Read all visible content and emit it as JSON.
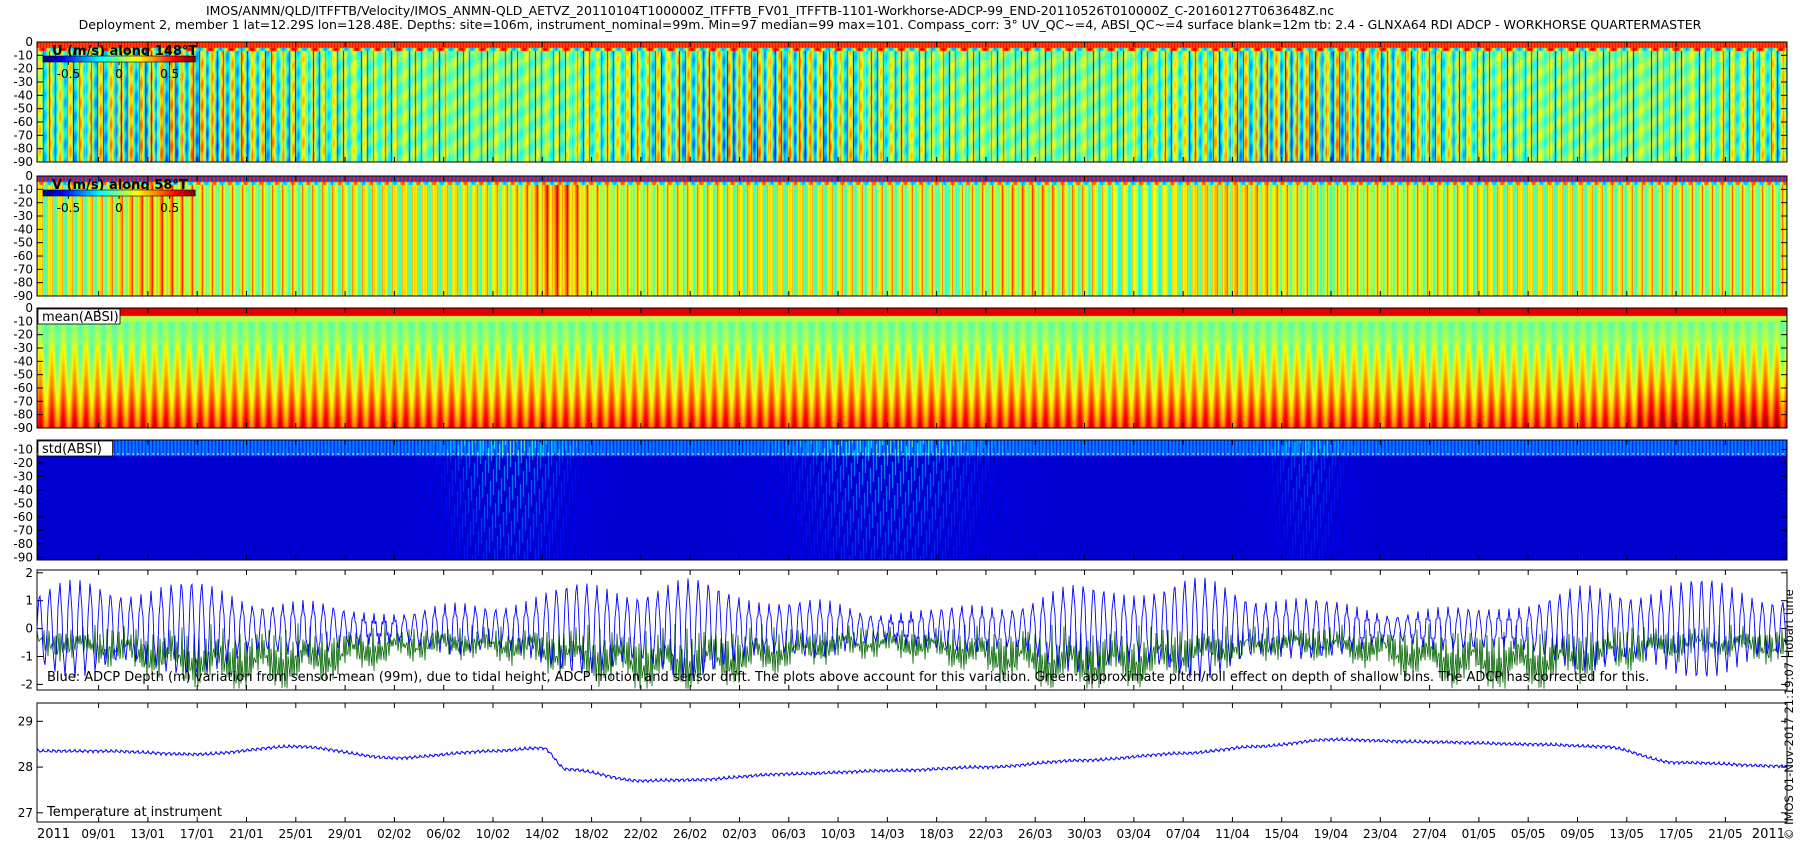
{
  "header": {
    "line1": "IMOS/ANMN/QLD/ITFFTB/Velocity/IMOS_ANMN-QLD_AETVZ_20110104T100000Z_ITFFTB_FV01_ITFFTB-1101-Workhorse-ADCP-99_END-20110526T010000Z_C-20160127T063648Z.nc",
    "line2": "Deployment 2, member 1 lat=12.29S lon=128.48E. Depths: site=106m, instrument_nominal=99m. Min=97 median=99 max=101. Compass_corr: 3° UV_QC~=4, ABSI_QC~=4 surface blank=12m tb: 2.4 - GLNXA64 RDI ADCP - WORKHORSE QUARTERMASTER"
  },
  "side_stamp": "© IMOS 01-Nov-2017 21:19:07 Hobart time",
  "colors": {
    "depth_line": "#0000ff",
    "pitch_roll_line": "#006400",
    "temperature_line": "#0000ff",
    "colormap": [
      "#00007f",
      "#0000ff",
      "#0080ff",
      "#00ffff",
      "#80ff80",
      "#ffff00",
      "#ff8000",
      "#ff0000",
      "#7f0000"
    ]
  },
  "x_axis": {
    "year_start": "2011",
    "year_end": "2011",
    "tick_labels": [
      "09/01",
      "13/01",
      "17/01",
      "21/01",
      "25/01",
      "29/01",
      "02/02",
      "06/02",
      "10/02",
      "14/02",
      "18/02",
      "22/02",
      "26/02",
      "02/03",
      "06/03",
      "10/03",
      "14/03",
      "18/03",
      "22/03",
      "26/03",
      "30/03",
      "03/04",
      "07/04",
      "11/04",
      "15/04",
      "19/04",
      "23/04",
      "27/04",
      "01/05",
      "05/05",
      "09/05",
      "13/05",
      "17/05",
      "21/05"
    ]
  },
  "panels": {
    "u": {
      "label": "U (m/s) along 148°T",
      "colorbar_ticks": [
        "-0.5",
        "0",
        "0.5"
      ],
      "y_ticks": [
        "0",
        "-10",
        "-20",
        "-30",
        "-40",
        "-50",
        "-60",
        "-70",
        "-80",
        "-90"
      ]
    },
    "v": {
      "label": "V (m/s) along 58°T",
      "colorbar_ticks": [
        "-0.5",
        "0",
        "0.5"
      ],
      "y_ticks": [
        "0",
        "-10",
        "-20",
        "-30",
        "-40",
        "-50",
        "-60",
        "-70",
        "-80",
        "-90"
      ]
    },
    "mean_absi": {
      "label": "mean(ABSI)",
      "y_ticks": [
        "0",
        "-10",
        "-20",
        "-30",
        "-40",
        "-50",
        "-60",
        "-70",
        "-80",
        "-90"
      ]
    },
    "std_absi": {
      "label": "std(ABSI)",
      "y_ticks": [
        "-10",
        "-20",
        "-30",
        "-40",
        "-50",
        "-60",
        "-70",
        "-80",
        "-90"
      ]
    },
    "depth": {
      "annotation": "Blue: ADCP Depth (m) variation from sensor-mean (99m), due to tidal height, ADCP motion and sensor drift. The plots above account for this variation. Green: approximate pitch/roll effect on depth of shallow bins. The ADCP has corrected for this.",
      "y_ticks": [
        "2",
        "1",
        "0",
        "-1",
        "-2"
      ]
    },
    "temperature": {
      "annotation": "Temperature at instrument",
      "y_ticks": [
        "29",
        "28",
        "27"
      ]
    }
  },
  "chart_data": [
    {
      "type": "heatmap",
      "name": "U (m/s) along 148°T",
      "x_range": [
        "2011-01-04",
        "2011-05-26"
      ],
      "y_range": [
        -90,
        0
      ],
      "color_range": [
        -0.75,
        0.75
      ],
      "description_values": "alternating tidal bands, mostly near 0"
    },
    {
      "type": "heatmap",
      "name": "V (m/s) along 58°T",
      "x_range": [
        "2011-01-04",
        "2011-05-26"
      ],
      "y_range": [
        -90,
        0
      ],
      "color_range": [
        -0.75,
        0.75
      ]
    },
    {
      "type": "heatmap",
      "name": "mean(ABSI)",
      "x_range": [
        "2011-01-04",
        "2011-05-26"
      ],
      "y_range": [
        -90,
        0
      ]
    },
    {
      "type": "heatmap",
      "name": "std(ABSI)",
      "x_range": [
        "2011-01-04",
        "2011-05-26"
      ],
      "y_range": [
        -90,
        0
      ]
    },
    {
      "type": "line",
      "x_range": [
        "2011-01-04",
        "2011-05-26"
      ],
      "ylim": [
        -2.2,
        2.1
      ],
      "series": [
        {
          "name": "ADCP Depth variation (m)",
          "color": "#0000ff",
          "amplitude_range": [
            -1.3,
            2.0
          ]
        },
        {
          "name": "pitch/roll effect",
          "color": "#006400",
          "amplitude_range": [
            -2.0,
            0.3
          ]
        }
      ]
    },
    {
      "type": "line",
      "x_range": [
        "2011-01-04",
        "2011-05-26"
      ],
      "ylim": [
        26.8,
        29.4
      ],
      "series": [
        {
          "name": "Temperature at instrument",
          "color": "#0000ff",
          "x": [
            "2011-01-04",
            "2011-01-09",
            "2011-01-17",
            "2011-01-25",
            "2011-02-02",
            "2011-02-10",
            "2011-02-14",
            "2011-02-16",
            "2011-02-22",
            "2011-02-26",
            "2011-03-06",
            "2011-03-14",
            "2011-03-22",
            "2011-03-30",
            "2011-04-07",
            "2011-04-13",
            "2011-04-19",
            "2011-04-27",
            "2011-05-05",
            "2011-05-11",
            "2011-05-17",
            "2011-05-26"
          ],
          "y": [
            28.35,
            28.35,
            28.28,
            28.45,
            28.2,
            28.35,
            28.42,
            27.95,
            27.7,
            27.72,
            27.85,
            27.92,
            28.0,
            28.15,
            28.3,
            28.45,
            28.6,
            28.55,
            28.5,
            28.45,
            28.1,
            28.02
          ]
        }
      ]
    }
  ]
}
